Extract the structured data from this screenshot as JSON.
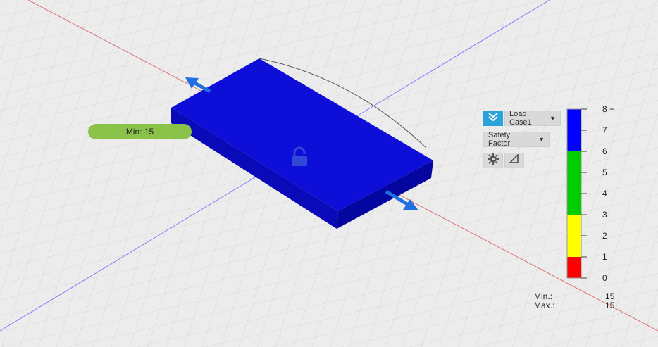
{
  "toolbar": {
    "load_case": "Load Case1",
    "result_type": "Safety Factor"
  },
  "icons": {
    "check": "double-chevron-check-icon",
    "settings": "gear-icon",
    "ruler": "triangle-ruler-icon",
    "lock": "lock-icon"
  },
  "callout": {
    "min_label": "Min: 15"
  },
  "legend": {
    "ticks": [
      "8 +",
      "7",
      "6",
      "5",
      "4",
      "3",
      "2",
      "1",
      "0"
    ],
    "bands": [
      {
        "from": 6,
        "to": 8,
        "color": "#0000ff"
      },
      {
        "from": 3,
        "to": 6,
        "color": "#00cc00"
      },
      {
        "from": 1,
        "to": 3,
        "color": "#ffff00"
      },
      {
        "from": 0,
        "to": 1,
        "color": "#ff0000"
      }
    ]
  },
  "stats": {
    "min_label": "Min.:",
    "min_value": "15",
    "max_label": "Max.:",
    "max_value": "15"
  },
  "colors": {
    "body_blue": "#0f0fd6",
    "arrow_blue": "#1e6fe0",
    "accent": "#2aa3d8",
    "callout_green": "#8bc34a"
  }
}
